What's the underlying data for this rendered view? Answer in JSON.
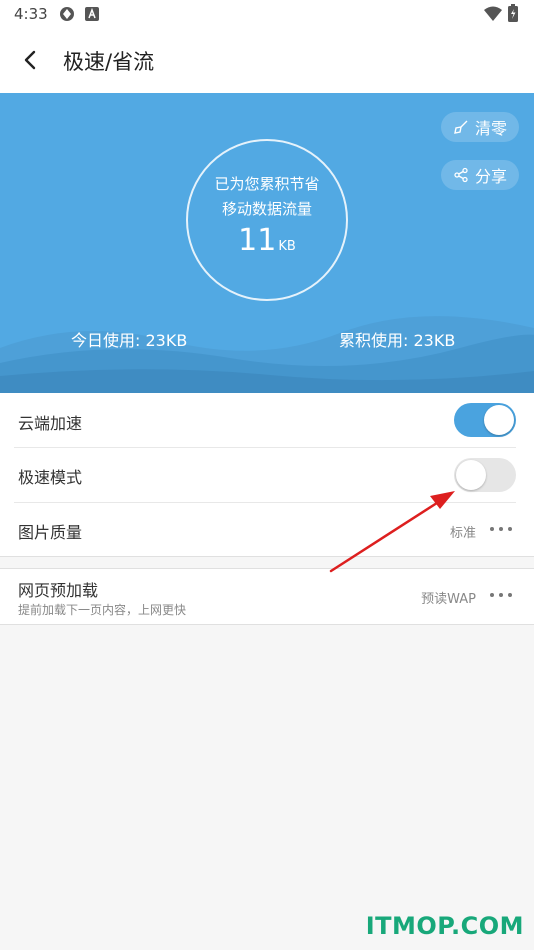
{
  "status_bar": {
    "time": "4:33"
  },
  "header": {
    "title": "极速/省流"
  },
  "hero": {
    "clear_label": "清零",
    "share_label": "分享",
    "circle_line1": "已为您累积节省",
    "circle_line2": "移动数据流量",
    "saved_value": "11",
    "saved_unit": "KB",
    "today_usage": "今日使用: 23KB",
    "total_usage": "累积使用: 23KB",
    "background_color": "#52a9e3"
  },
  "settings": {
    "cloud_accel": {
      "label": "云端加速",
      "enabled": true
    },
    "turbo_mode": {
      "label": "极速模式",
      "enabled": false
    },
    "image_quality": {
      "label": "图片质量",
      "value": "标准"
    },
    "preload": {
      "label": "网页预加载",
      "subtitle": "提前加载下一页内容，上网更快",
      "value": "预读WAP"
    }
  },
  "accent_color": "#4aa3df",
  "watermark": "ITMOP.COM"
}
